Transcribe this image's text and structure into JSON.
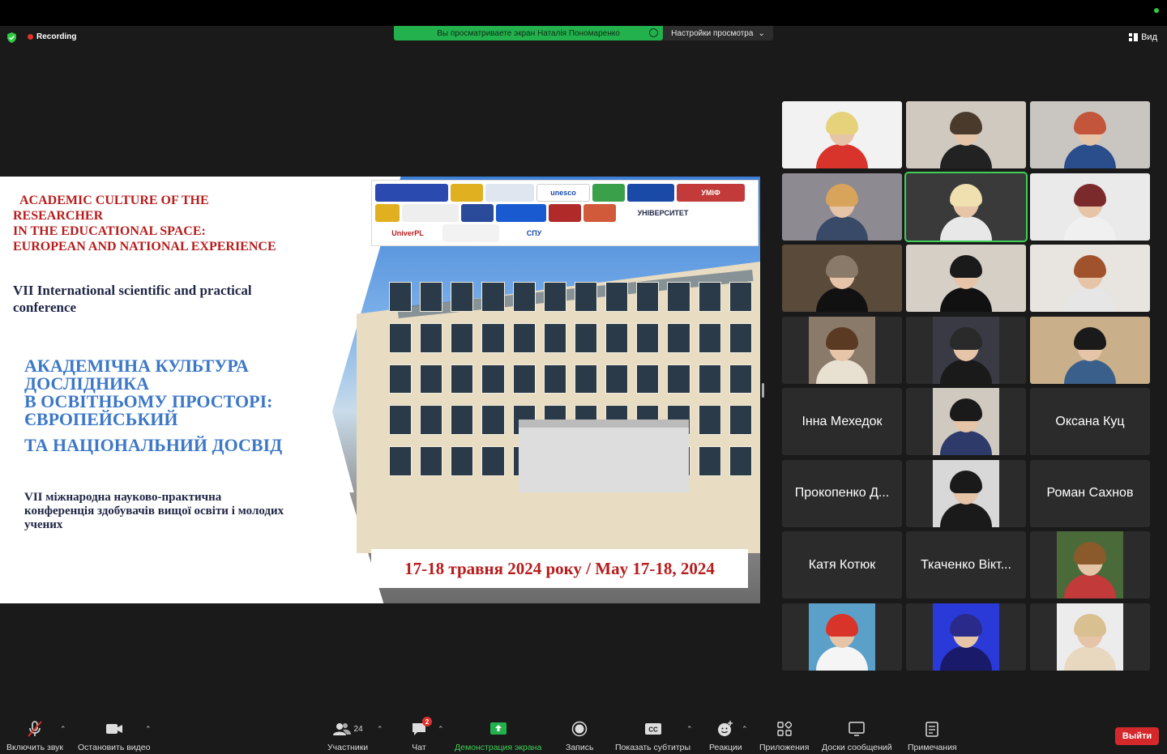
{
  "meeting": {
    "recording_label": "Recording",
    "share_banner": "Вы просматриваете экран Наталія Пономаренко",
    "view_options": "Настройки просмотра",
    "view_button": "Вид"
  },
  "slide": {
    "en_title_lines": [
      "ACADEMIC CULTURE OF THE",
      "RESEARCHER",
      "IN THE EDUCATIONAL SPACE:",
      "EUROPEAN AND NATIONAL EXPERIENCE"
    ],
    "en_subtitle": "VII International scientific and practical conference",
    "ua_title_lines": [
      "АКАДЕМІЧНА КУЛЬТУРА",
      "ДОСЛІДНИКА",
      "В ОСВІТНЬОМУ ПРОСТОРІ:",
      "ЄВРОПЕЙСЬКИЙ"
    ],
    "ua_title_last": "ТА НАЦІОНАЛЬНИЙ ДОСВІД",
    "ua_subtitle": "VII міжнародна науково-практична конференція здобувачів вищої освіти і молодих учених",
    "date": "17-18 травня 2024 року / May 17-18, 2024",
    "logos": [
      "УМІФ",
      "unesco",
      "UniverPL",
      "СПУ",
      "УНІВЕРСИТЕТ"
    ]
  },
  "participants": [
    {
      "name": "",
      "type": "video",
      "hair": "#e6d27a",
      "shirt": "#d9342b",
      "bg": "#f2f2f2"
    },
    {
      "name": "",
      "type": "video",
      "hair": "#4a3a2c",
      "shirt": "#222222",
      "bg": "#cfc9c0"
    },
    {
      "name": "",
      "type": "video",
      "hair": "#c2553a",
      "shirt": "#2a4d8c",
      "bg": "#c9c6c2"
    },
    {
      "name": "",
      "type": "video",
      "hair": "#d8a35a",
      "shirt": "#394a68",
      "bg": "#8e8a92"
    },
    {
      "name": "",
      "type": "video",
      "hair": "#f0e0b0",
      "shirt": "#e8e8e8",
      "bg": "#3a3a3a"
    },
    {
      "name": "",
      "type": "video",
      "hair": "#7a2a2a",
      "shirt": "#f0f0f0",
      "bg": "#eaeaea"
    },
    {
      "name": "",
      "type": "video",
      "hair": "#8a7a6a",
      "shirt": "#111111",
      "bg": "#5a4a3a"
    },
    {
      "name": "",
      "type": "video",
      "hair": "#1a1a1a",
      "shirt": "#111111",
      "bg": "#d6cfc6"
    },
    {
      "name": "",
      "type": "video",
      "hair": "#a0522d",
      "shirt": "#e6e6e6",
      "bg": "#e8e4e0"
    },
    {
      "name": "",
      "type": "inset",
      "hair": "#5a3a22",
      "shirt": "#e8e0d0",
      "bg": "#8a7a6a"
    },
    {
      "name": "",
      "type": "inset",
      "hair": "#2a2a2a",
      "shirt": "#1a1a1a",
      "bg": "#3a3a44"
    },
    {
      "name": "",
      "type": "video",
      "hair": "#1a1a1a",
      "shirt": "#3a5f8a",
      "bg": "#c9b08a"
    },
    {
      "name": "Інна Мехедок",
      "type": "name"
    },
    {
      "name": "",
      "type": "inset",
      "hair": "#1a1a1a",
      "shirt": "#2d3a6a",
      "bg": "#cfc9c0"
    },
    {
      "name": "Оксана Куц",
      "type": "name"
    },
    {
      "name": "Прокопенко Д...",
      "type": "name"
    },
    {
      "name": "",
      "type": "inset",
      "hair": "#1a1a1a",
      "shirt": "#1a1a1a",
      "bg": "#d8d8d8"
    },
    {
      "name": "Роман Сахнов",
      "type": "name"
    },
    {
      "name": "Катя Котюк",
      "type": "name"
    },
    {
      "name": "Ткаченко Вікт...",
      "type": "name"
    },
    {
      "name": "",
      "type": "inset",
      "hair": "#8a5a2a",
      "shirt": "#c23a3a",
      "bg": "#4a6a3a"
    },
    {
      "name": "",
      "type": "inset",
      "hair": "#d8342a",
      "shirt": "#f5f5f5",
      "bg": "#5aa0c8"
    },
    {
      "name": "",
      "type": "inset",
      "hair": "#2a2a8a",
      "shirt": "#1a1a6a",
      "bg": "#2a3ad8"
    },
    {
      "name": "",
      "type": "inset",
      "hair": "#d8c090",
      "shirt": "#e8d8c0",
      "bg": "#ececec"
    }
  ],
  "toolbar": {
    "mute": "Включить звук",
    "video": "Остановить видео",
    "participants": "Участники",
    "participants_count": "24",
    "chat": "Чат",
    "chat_badge": "2",
    "share": "Демонстрация экрана",
    "record": "Запись",
    "captions": "Показать субтитры",
    "reactions": "Реакции",
    "apps": "Приложения",
    "whiteboards": "Доски сообщений",
    "notes": "Примечания",
    "leave": "Выйти"
  }
}
